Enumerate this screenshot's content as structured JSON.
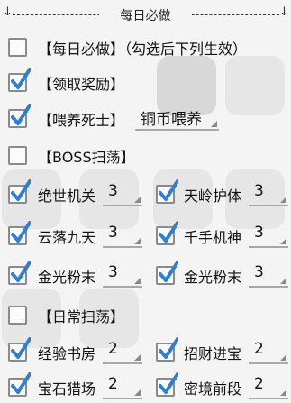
{
  "header": {
    "title": "每日必做",
    "left_arrow": "↓",
    "right_arrow": "↓"
  },
  "rows": [
    {
      "checked": false,
      "label": "【每日必做】（勾选后下列生效）"
    },
    {
      "checked": true,
      "label": "【领取奖励】"
    },
    {
      "checked": true,
      "label": "【喂养死士】",
      "select": "铜币喂养"
    },
    {
      "checked": false,
      "label": "【BOSS扫荡】"
    },
    {
      "left": {
        "checked": true,
        "label": "绝世机关",
        "value": "3"
      },
      "right": {
        "checked": true,
        "label": "天岭护体",
        "value": "3"
      }
    },
    {
      "left": {
        "checked": true,
        "label": "云落九天",
        "value": "3"
      },
      "right": {
        "checked": true,
        "label": "千手机神",
        "value": "3"
      }
    },
    {
      "left": {
        "checked": true,
        "label": "金光粉末",
        "value": "3"
      },
      "right": {
        "checked": true,
        "label": "金光粉末",
        "value": "3"
      }
    },
    {
      "checked": false,
      "label": "【日常扫荡】"
    },
    {
      "left": {
        "checked": true,
        "label": "经验书房",
        "value": "2"
      },
      "right": {
        "checked": true,
        "label": "招财进宝",
        "value": "2"
      }
    },
    {
      "left": {
        "checked": true,
        "label": "宝石猎场",
        "value": "2"
      },
      "right": {
        "checked": true,
        "label": "密境前段",
        "value": "2"
      }
    }
  ],
  "colors": {
    "check": "#2d7fd6",
    "accent": "#1f6fc5"
  }
}
